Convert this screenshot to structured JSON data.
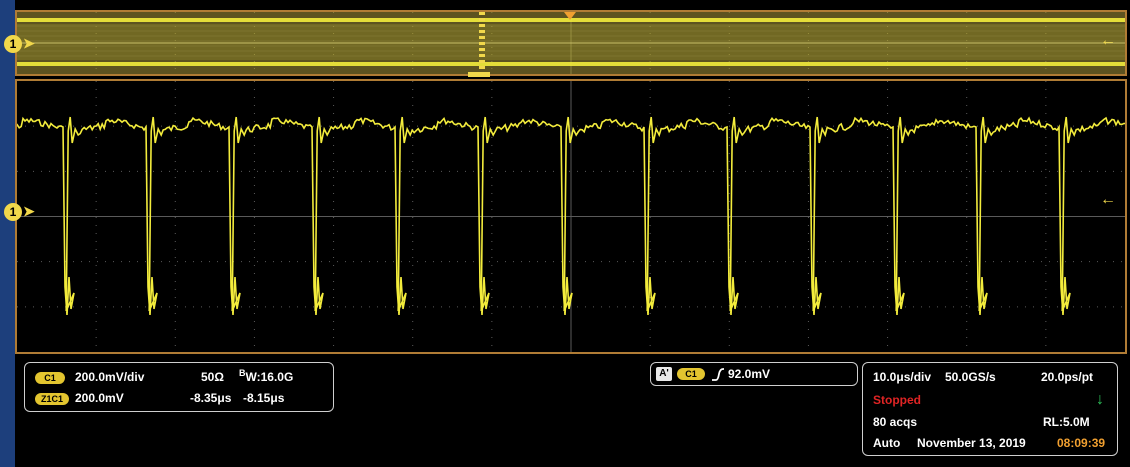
{
  "channel_marker": "1",
  "channel1": {
    "scale": "200.0mV/div",
    "impedance": "50Ω",
    "bandwidth_prefix": "B",
    "bandwidth_sub": "W",
    "bandwidth": ":16.0G",
    "label": "C1"
  },
  "zoom": {
    "label": "Z1C1",
    "offset": "200.0mV",
    "start": "-8.35μs",
    "end": "-8.15μs"
  },
  "trigger": {
    "mode_label": "A'",
    "channel_label": "C1",
    "slope_icon": "rising-edge-icon",
    "level": "92.0mV"
  },
  "acquisition": {
    "horizontal_scale": "10.0μs/div",
    "sample_rate": "50.0GS/s",
    "resolution": "20.0ps/pt",
    "state": "Stopped",
    "acqs": "80 acqs",
    "record_length": "RL:5.0M",
    "mode": "Auto",
    "date": "November 13, 2019",
    "time": "08:09:39",
    "state_icon": "down-arrow-icon"
  },
  "colors": {
    "trace": "#f3ec3c",
    "grid": "#5a5a5a",
    "frame": "#b07c35",
    "overview_bg": "#5d5320",
    "stopped": "#e02424",
    "timestamp": "#f1a030"
  }
}
